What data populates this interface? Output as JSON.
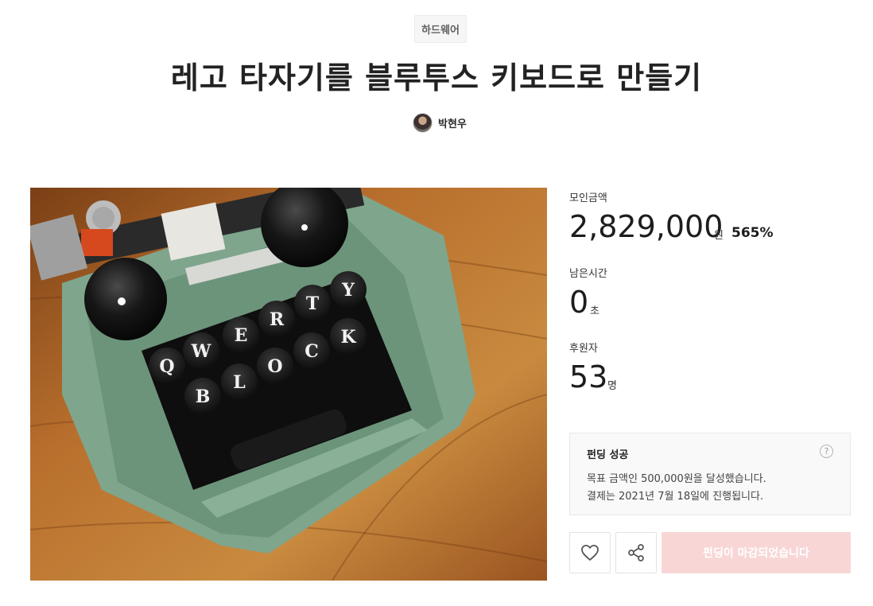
{
  "header": {
    "category": "하드웨어",
    "title": "레고 타자기를 블루투스 키보드로 만들기",
    "creator": "박현우"
  },
  "hero": {
    "keys_row1": [
      "Q",
      "W",
      "E",
      "R",
      "T",
      "Y"
    ],
    "keys_row2": [
      "B",
      "L",
      "O",
      "C",
      "K"
    ]
  },
  "stats": {
    "raised_label": "모인금액",
    "raised_value": "2,829,000",
    "raised_unit": "원",
    "percent": "565%",
    "time_label": "남은시간",
    "time_value": "0",
    "time_unit": "초",
    "backers_label": "후원자",
    "backers_value": "53",
    "backers_unit": "명"
  },
  "notice": {
    "title": "펀딩 성공",
    "line1": "목표 금액인 500,000원을 달성했습니다.",
    "line2": "결제는 2021년 7월 18일에 진행됩니다.",
    "help_icon": "?"
  },
  "actions": {
    "like_icon": "heart-icon",
    "share_icon": "share-icon",
    "cta_label": "펀딩이 마감되었습니다"
  },
  "colors": {
    "cta_background": "#f8d6d6",
    "lego_green": "#7fa58d",
    "wood": "#b06a2c"
  }
}
